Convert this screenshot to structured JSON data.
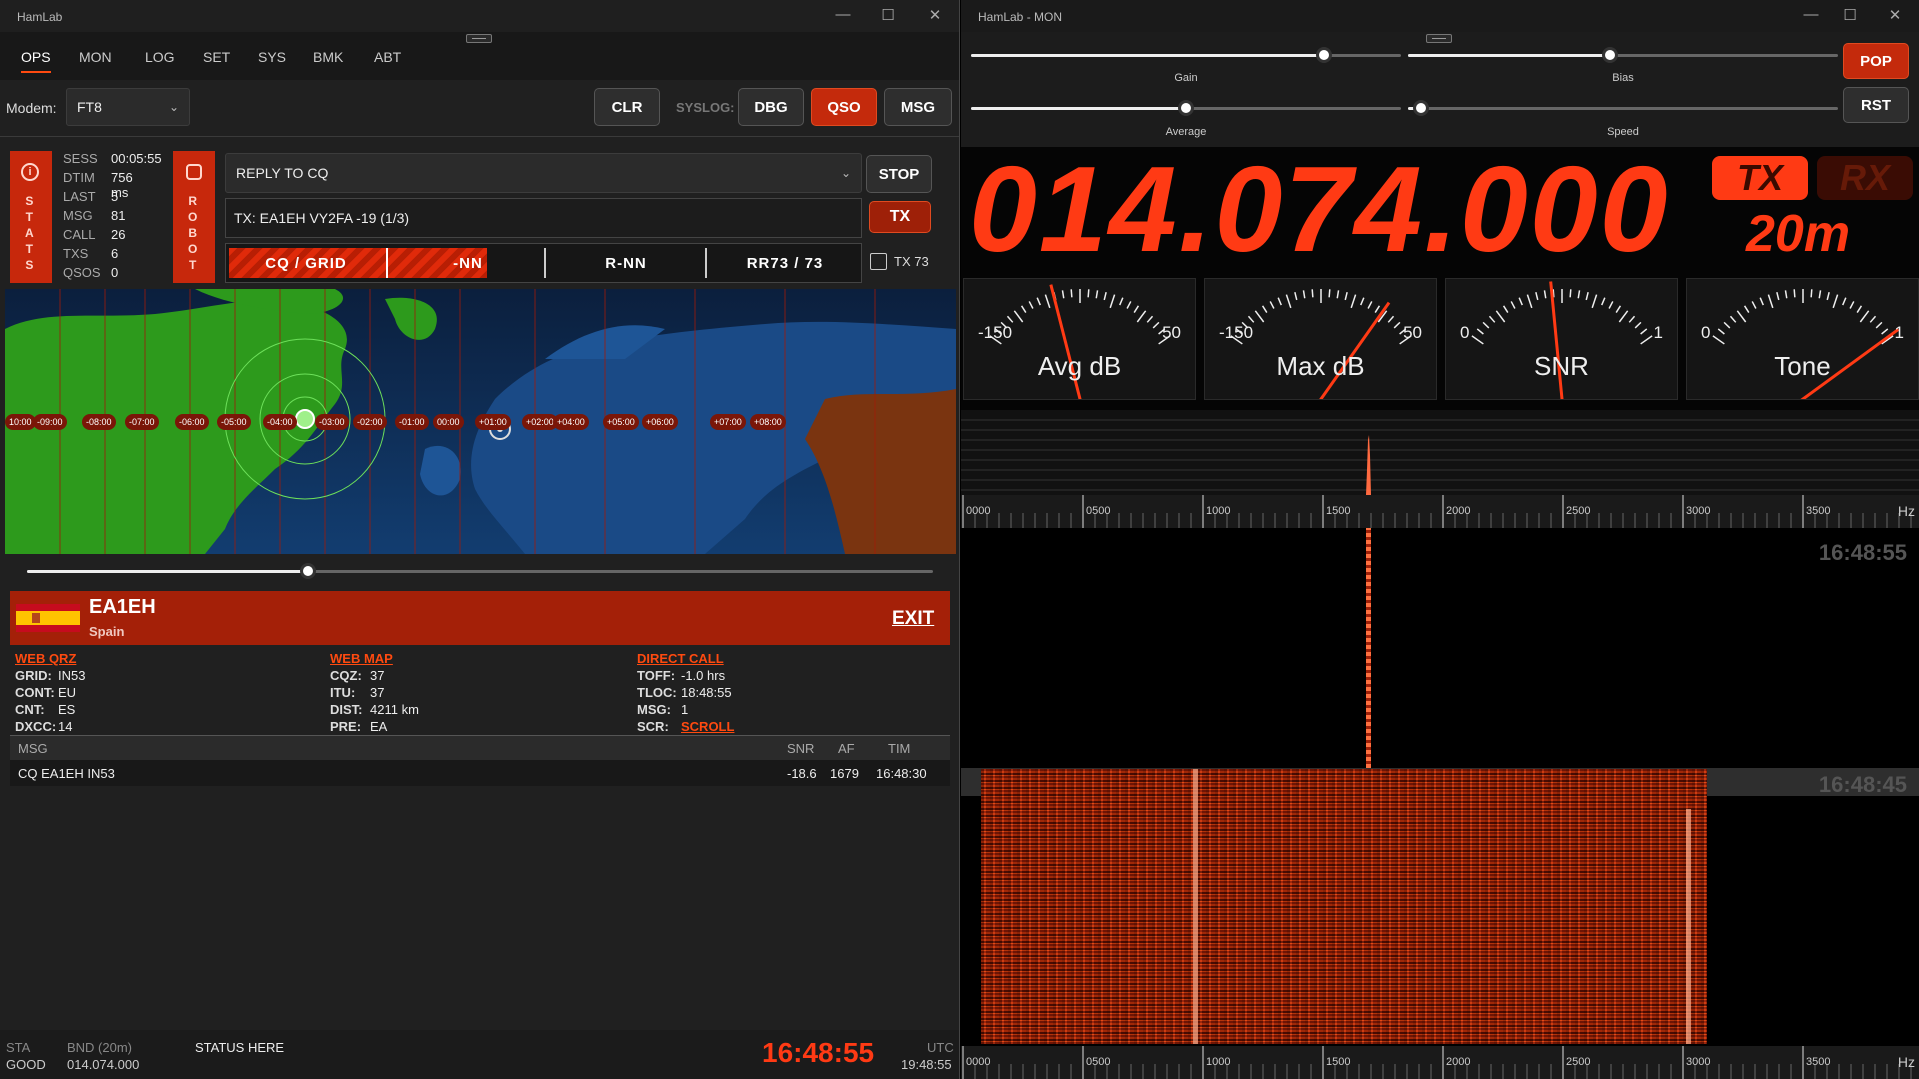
{
  "left": {
    "title": "HamLab",
    "nav": [
      "OPS",
      "MON",
      "LOG",
      "SET",
      "SYS",
      "BMK",
      "ABT"
    ],
    "modem_label": "Modem:",
    "modem_value": "FT8",
    "buttons": {
      "clr": "CLR",
      "syslog": "SYSLOG:",
      "dbg": "DBG",
      "qso": "QSO",
      "msg": "MSG",
      "stop": "STOP",
      "tx": "TX",
      "exit": "EXIT"
    },
    "stats_letters": [
      "S",
      "T",
      "A",
      "T",
      "S"
    ],
    "robot_letters": [
      "R",
      "O",
      "B",
      "O",
      "T"
    ],
    "stats": [
      {
        "k": "SESS",
        "v": "00:05:55"
      },
      {
        "k": "DTIM",
        "v": "756 ms"
      },
      {
        "k": "LAST",
        "v": "5"
      },
      {
        "k": "MSG",
        "v": "81"
      },
      {
        "k": "CALL",
        "v": "26"
      },
      {
        "k": "TXS",
        "v": "6"
      },
      {
        "k": "QSOS",
        "v": "0"
      }
    ],
    "reply_combo": "REPLY TO CQ",
    "tx_message": "TX: EA1EH VY2FA -19 (1/3)",
    "steps": [
      "CQ / GRID",
      "-NN",
      "R-NN",
      "RR73 / 73"
    ],
    "tx73_label": "TX 73",
    "timezones": [
      "10:00",
      "-09:00",
      "-08:00",
      "-07:00",
      "-06:00",
      "-05:00",
      "-04:00",
      "-03:00",
      "-02:00",
      "-01:00",
      "00:00",
      "+01:00",
      "+02:00",
      "+04:00",
      "+05:00",
      "+06:00",
      "+07:00",
      "+08:00"
    ],
    "map_slider": 0.31,
    "contact": {
      "call": "EA1EH",
      "country": "Spain"
    },
    "links": {
      "qrz": "WEB QRZ",
      "map": "WEB MAP",
      "direct": "DIRECT CALL",
      "scroll": "SCROLL"
    },
    "col1": [
      {
        "k": "GRID:",
        "v": "IN53"
      },
      {
        "k": "CONT:",
        "v": "EU"
      },
      {
        "k": "CNT:",
        "v": "ES"
      },
      {
        "k": "DXCC:",
        "v": "14"
      }
    ],
    "col2": [
      {
        "k": "CQZ:",
        "v": "37"
      },
      {
        "k": "ITU:",
        "v": "37"
      },
      {
        "k": "DIST:",
        "v": "4211 km"
      },
      {
        "k": "PRE:",
        "v": "EA"
      }
    ],
    "col3": [
      {
        "k": "TOFF:",
        "v": "-1.0 hrs"
      },
      {
        "k": "TLOC:",
        "v": "18:48:55"
      },
      {
        "k": "MSG:",
        "v": "1"
      },
      {
        "k": "SCR:",
        "v": ""
      }
    ],
    "table": {
      "headers": [
        "MSG",
        "SNR",
        "AF",
        "TIM"
      ],
      "rows": [
        {
          "msg": "CQ EA1EH IN53",
          "snr": "-18.6",
          "af": "1679",
          "tim": "16:48:30"
        }
      ]
    },
    "status": {
      "sta_k": "STA",
      "sta_v": "GOOD",
      "bnd_k": "BND (20m)",
      "bnd_v": "014.074.000",
      "text": "STATUS HERE",
      "clock": "16:48:55",
      "utc_k": "UTC",
      "utc_v": "19:48:55"
    }
  },
  "right": {
    "title": "HamLab - MON",
    "sliders": [
      {
        "label": "Gain",
        "value": 0.82
      },
      {
        "label": "Bias",
        "value": 0.47
      },
      {
        "label": "Average",
        "value": 0.5
      },
      {
        "label": "Speed",
        "value": 0.03
      }
    ],
    "pop": "POP",
    "rst": "RST",
    "frequency": "014.074.000",
    "tx": "TX",
    "rx": "RX",
    "band": "20m",
    "gauges": [
      {
        "name": "Avg dB",
        "min": "-150",
        "max": "50",
        "value": 0.37
      },
      {
        "name": "Max dB",
        "min": "-150",
        "max": "50",
        "value": 0.82
      },
      {
        "name": "SNR",
        "min": "0",
        "max": "1",
        "value": 0.45
      },
      {
        "name": "Tone",
        "min": "0",
        "max": "1",
        "value": 0.99
      }
    ],
    "hz_ticks": [
      "0000",
      "0500",
      "1000",
      "1500",
      "2000",
      "2500",
      "3000",
      "3500"
    ],
    "hz_unit": "Hz",
    "waterfall_times": [
      "16:48:55",
      "16:48:45"
    ],
    "colors": {
      "accent": "#ff3a14",
      "panel": "#c7280c"
    }
  }
}
